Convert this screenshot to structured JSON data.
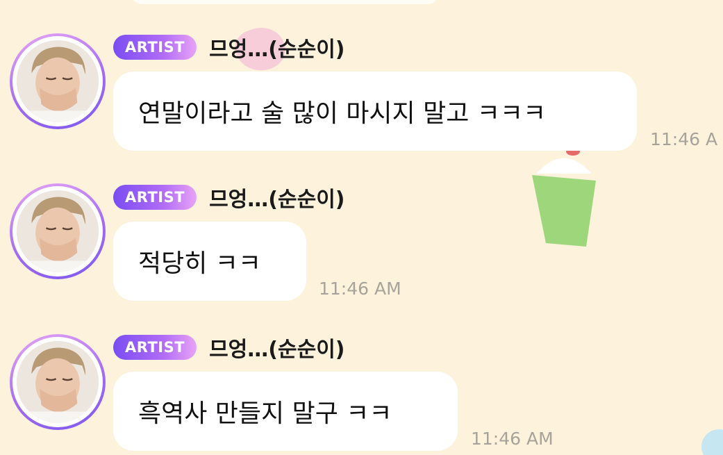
{
  "messages": [
    {
      "badge": "ARTIST",
      "sender": "므엉…(순순이)",
      "text": "연말이라고 술 많이 마시지 말고 ㅋㅋㅋ",
      "time": "11:46 A"
    },
    {
      "badge": "ARTIST",
      "sender": "므엉…(순순이)",
      "text": "적당히 ㅋㅋ",
      "time": "11:46 AM"
    },
    {
      "badge": "ARTIST",
      "sender": "므엉…(순순이)",
      "text": "흑역사 만들지 말구 ㅋㅋ",
      "time": "11:46 AM"
    }
  ],
  "colors": {
    "background": "#fdf3dc",
    "bubble": "#ffffff",
    "badge_start": "#7a4df2",
    "badge_end": "#e8a2f7",
    "timestamp": "#a7a39b"
  },
  "icons": {
    "avatar": "artist-profile-photo"
  }
}
